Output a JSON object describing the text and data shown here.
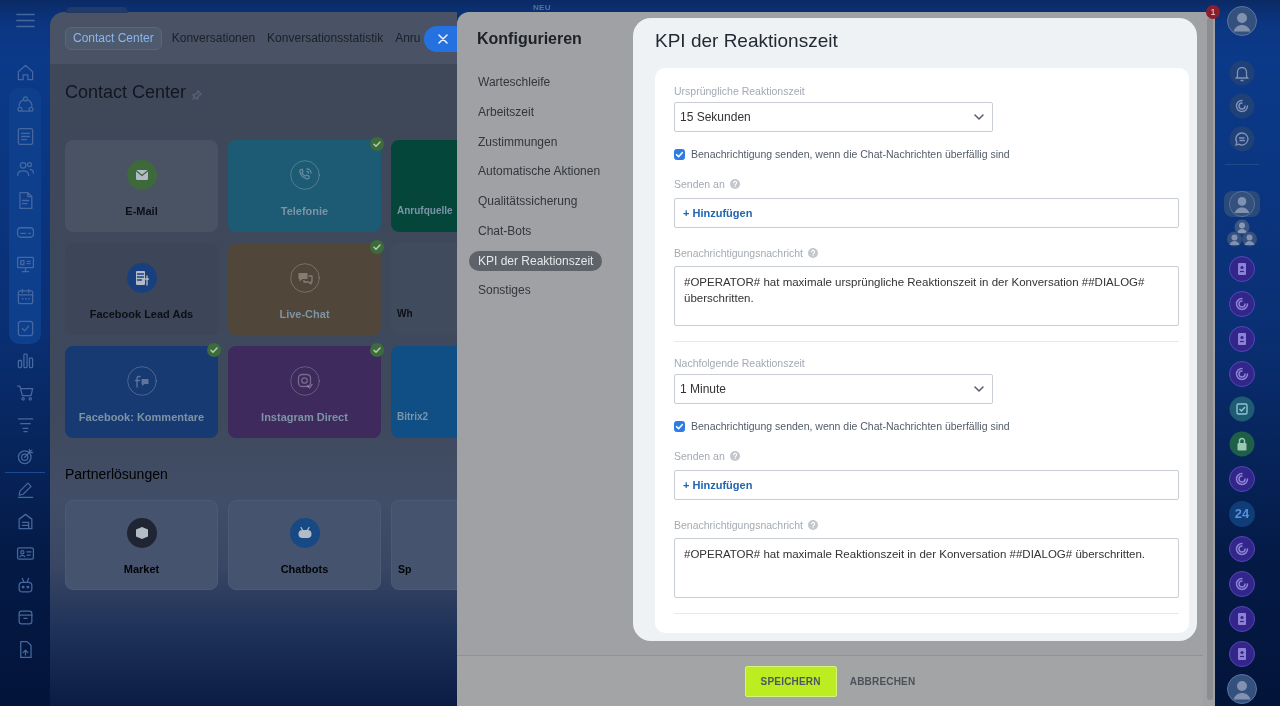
{
  "top_bar": {
    "badge": "NEU"
  },
  "background_page": {
    "tabs": [
      {
        "label": "Contact Center",
        "selected": true
      },
      {
        "label": "Konversationen",
        "selected": false
      },
      {
        "label": "Konversationsstatistik",
        "selected": false
      },
      {
        "label": "Anru",
        "selected": false
      }
    ],
    "title": "Contact Center",
    "tiles": [
      {
        "label": "E-Mail",
        "kind": "mail",
        "color": "#4a5363",
        "connected": false,
        "checked": false
      },
      {
        "label": "Telefonie",
        "kind": "phone",
        "color": "#1d5a74",
        "connected": true,
        "checked": true
      },
      {
        "label": "Anrufquelle",
        "color": "#05463b",
        "connected": true,
        "checked": false
      },
      {
        "label": "Facebook Lead Ads",
        "kind": "lead",
        "color": "#3c4658",
        "connected": false,
        "checked": false
      },
      {
        "label": "Live-Chat",
        "kind": "chat",
        "color": "#51463a",
        "connected": true,
        "checked": true
      },
      {
        "label": "Wh",
        "color": "#414b5e",
        "connected": false,
        "checked": false
      },
      {
        "label": "Facebook: Kommentare",
        "kind": "comments",
        "color": "#173a72",
        "connected": true,
        "checked": true
      },
      {
        "label": "Instagram Direct",
        "kind": "instagram",
        "color": "#3e2a5c",
        "connected": true,
        "checked": true
      },
      {
        "label": "Bitrix2",
        "color": "#0f4f86",
        "connected": true,
        "checked": false
      }
    ],
    "partner_title": "Partnerlösungen",
    "partner_tiles": [
      {
        "label": "Market",
        "kind": "market"
      },
      {
        "label": "Chatbots",
        "kind": "chatbots"
      },
      {
        "label": "Sp"
      }
    ]
  },
  "settings_panel": {
    "title": "Konfigurieren",
    "menu": [
      {
        "label": "Warteschleife",
        "selected": false
      },
      {
        "label": "Arbeitszeit",
        "selected": false
      },
      {
        "label": "Zustimmungen",
        "selected": false
      },
      {
        "label": "Automatische Aktionen",
        "selected": false
      },
      {
        "label": "Qualitätssicherung",
        "selected": false
      },
      {
        "label": "Chat-Bots",
        "selected": false
      },
      {
        "label": "KPI der Reaktionszeit",
        "selected": true
      },
      {
        "label": "Sonstiges",
        "selected": false
      }
    ]
  },
  "kpi_panel": {
    "title": "KPI der Reaktionszeit",
    "sections": [
      {
        "time_label": "Ursprüngliche Reaktionszeit",
        "time_value": "15 Sekunden",
        "notify": {
          "label": "Benachrichtigung senden, wenn die Chat-Nachrichten überfällig sind",
          "checked": true
        },
        "recipients_label": "Senden an",
        "add_link": "+ Hinzufügen",
        "message_label": "Benachrichtigungsnachricht",
        "message": "#OPERATOR# hat maximale ursprüngliche Reaktionszeit in der Konversation ##DIALOG# überschritten."
      },
      {
        "time_label": "Nachfolgende Reaktionszeit",
        "time_value": "1 Minute",
        "notify": {
          "label": "Benachrichtigung senden, wenn die Chat-Nachrichten überfällig sind",
          "checked": true
        },
        "recipients_label": "Senden an",
        "add_link": "+ Hinzufügen",
        "message_label": "Benachrichtigungsnachricht",
        "message": "#OPERATOR# hat maximale Reaktionszeit in der Konversation ##DIALOG# überschritten."
      }
    ]
  },
  "footer": {
    "buttons": [
      {
        "label": "SPEICHERN",
        "kind": "primary"
      },
      {
        "label": "ABBRECHEN",
        "kind": "link"
      }
    ]
  },
  "right_sidebar": {
    "notification_count": "1",
    "app_label": "24"
  }
}
